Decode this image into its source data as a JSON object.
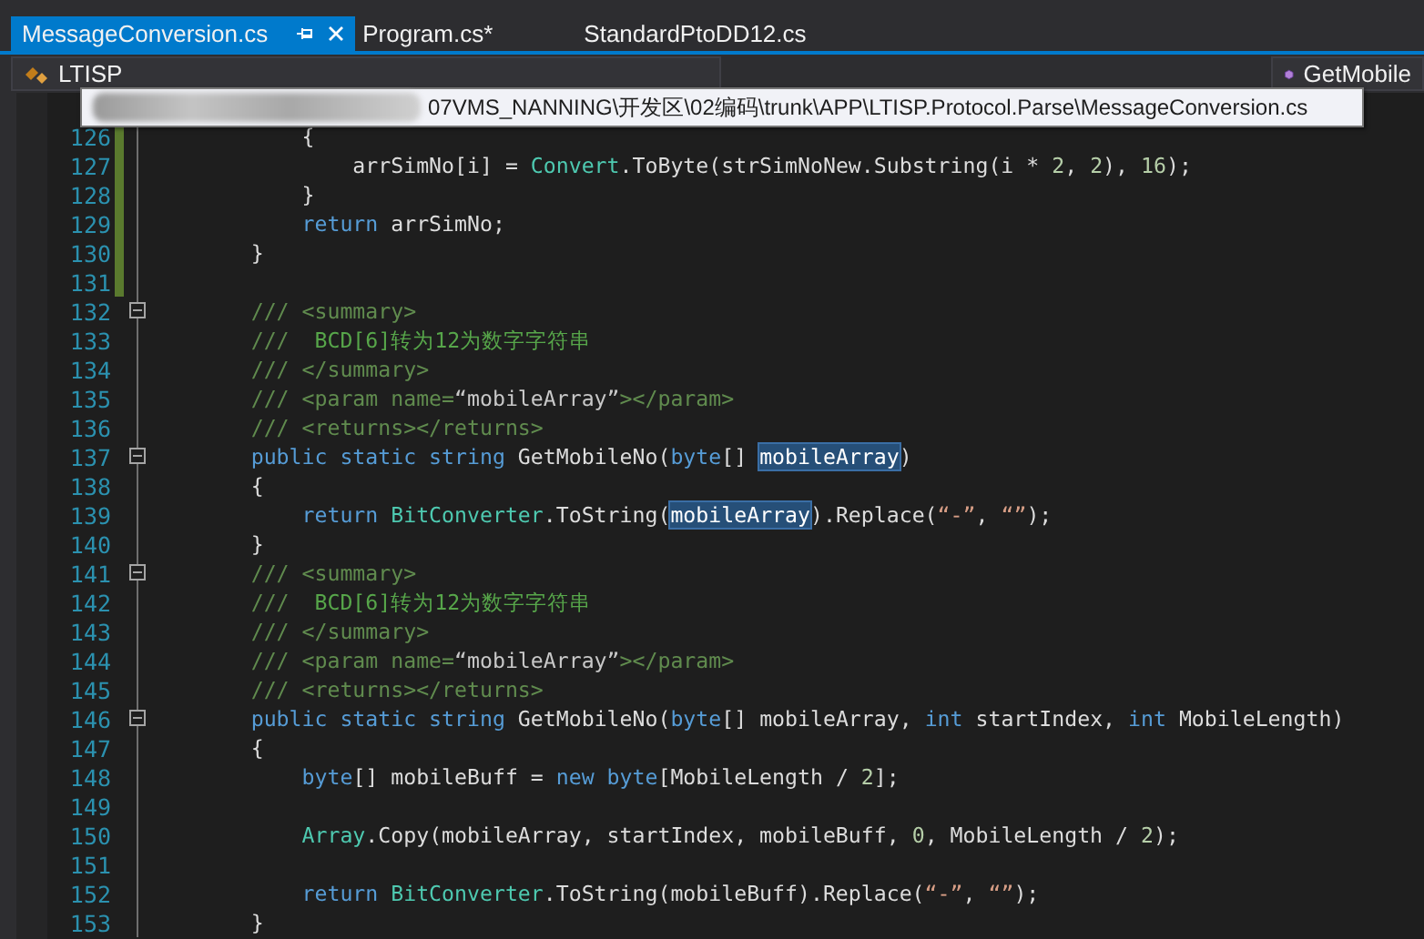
{
  "tabs": [
    {
      "label": "MessageConversion.cs",
      "selected": true
    },
    {
      "label": "Program.cs*",
      "selected": false
    },
    {
      "label": "StandardPtoDD12.cs",
      "selected": false
    }
  ],
  "navigation": {
    "left": "LTISP",
    "right": "GetMobile"
  },
  "tooltip": {
    "text": "07VMS_NANNING\\开发区\\02编码\\trunk\\APP\\LTISP.Protocol.Parse\\MessageConversion.cs"
  },
  "lines": [
    {
      "number": "126",
      "changed": true,
      "fold_toggle": false,
      "tokens": [
        {
          "kind": "plain",
          "text": "            {"
        }
      ]
    },
    {
      "number": "127",
      "changed": true,
      "fold_toggle": false,
      "tokens": [
        {
          "kind": "plain",
          "text": "                arrSimNo[i] = "
        },
        {
          "kind": "type",
          "text": "Convert"
        },
        {
          "kind": "plain",
          "text": ".ToByte(strSimNoNew.Substring(i * "
        },
        {
          "kind": "number",
          "text": "2"
        },
        {
          "kind": "plain",
          "text": ", "
        },
        {
          "kind": "number",
          "text": "2"
        },
        {
          "kind": "plain",
          "text": "), "
        },
        {
          "kind": "number",
          "text": "16"
        },
        {
          "kind": "plain",
          "text": ");"
        }
      ]
    },
    {
      "number": "128",
      "changed": true,
      "fold_toggle": false,
      "tokens": [
        {
          "kind": "plain",
          "text": "            }"
        }
      ]
    },
    {
      "number": "129",
      "changed": true,
      "fold_toggle": false,
      "tokens": [
        {
          "kind": "keyword",
          "text": "            return"
        },
        {
          "kind": "plain",
          "text": " arrSimNo;"
        }
      ]
    },
    {
      "number": "130",
      "changed": true,
      "fold_toggle": false,
      "tokens": [
        {
          "kind": "plain",
          "text": "        }"
        }
      ]
    },
    {
      "number": "131",
      "changed": true,
      "fold_toggle": false
    },
    {
      "number": "132",
      "changed": false,
      "fold_toggle": true,
      "tokens": [
        {
          "kind": "doc",
          "text": "        /// <summary>"
        }
      ]
    },
    {
      "number": "133",
      "changed": false,
      "fold_toggle": false,
      "tokens": [
        {
          "kind": "doc",
          "text": "        /// "
        },
        {
          "kind": "doc-text",
          "text": " BCD[6]转为12为数字字符串"
        }
      ]
    },
    {
      "number": "134",
      "changed": false,
      "fold_toggle": false,
      "tokens": [
        {
          "kind": "doc",
          "text": "        /// </summary>"
        }
      ]
    },
    {
      "number": "135",
      "changed": false,
      "fold_toggle": false,
      "tokens": [
        {
          "kind": "doc",
          "text": "        /// <param name="
        },
        {
          "kind": "doc-attr",
          "text": "“mobileArray”"
        },
        {
          "kind": "doc",
          "text": "></param>"
        }
      ]
    },
    {
      "number": "136",
      "changed": false,
      "fold_toggle": false,
      "tokens": [
        {
          "kind": "doc",
          "text": "        /// <returns></returns>"
        }
      ]
    },
    {
      "number": "137",
      "changed": false,
      "fold_toggle": true,
      "tokens": [
        {
          "kind": "keyword",
          "text": "        public static string"
        },
        {
          "kind": "plain",
          "text": " GetMobileNo("
        },
        {
          "kind": "keyword",
          "text": "byte"
        },
        {
          "kind": "plain",
          "text": "[] "
        },
        {
          "kind": "highlight",
          "text": "mobileArray"
        },
        {
          "kind": "plain",
          "text": ")"
        }
      ]
    },
    {
      "number": "138",
      "changed": false,
      "fold_toggle": false,
      "tokens": [
        {
          "kind": "plain",
          "text": "        {"
        }
      ]
    },
    {
      "number": "139",
      "changed": false,
      "fold_toggle": false,
      "tokens": [
        {
          "kind": "keyword",
          "text": "            return"
        },
        {
          "kind": "type",
          "text": " BitConverter"
        },
        {
          "kind": "plain",
          "text": ".ToString("
        },
        {
          "kind": "highlight",
          "text": "mobileArray"
        },
        {
          "kind": "plain",
          "text": ").Replace("
        },
        {
          "kind": "string",
          "text": "“-”"
        },
        {
          "kind": "plain",
          "text": ", "
        },
        {
          "kind": "string",
          "text": "“”"
        },
        {
          "kind": "plain",
          "text": ");"
        }
      ]
    },
    {
      "number": "140",
      "changed": false,
      "fold_toggle": false,
      "tokens": [
        {
          "kind": "plain",
          "text": "        }"
        }
      ]
    },
    {
      "number": "141",
      "changed": false,
      "fold_toggle": true,
      "tokens": [
        {
          "kind": "doc",
          "text": "        /// <summary>"
        }
      ]
    },
    {
      "number": "142",
      "changed": false,
      "fold_toggle": false,
      "tokens": [
        {
          "kind": "doc",
          "text": "        /// "
        },
        {
          "kind": "doc-text",
          "text": " BCD[6]转为12为数字字符串"
        }
      ]
    },
    {
      "number": "143",
      "changed": false,
      "fold_toggle": false,
      "tokens": [
        {
          "kind": "doc",
          "text": "        /// </summary>"
        }
      ]
    },
    {
      "number": "144",
      "changed": false,
      "fold_toggle": false,
      "tokens": [
        {
          "kind": "doc",
          "text": "        /// <param name="
        },
        {
          "kind": "doc-attr",
          "text": "“mobileArray”"
        },
        {
          "kind": "doc",
          "text": "></param>"
        }
      ]
    },
    {
      "number": "145",
      "changed": false,
      "fold_toggle": false,
      "tokens": [
        {
          "kind": "doc",
          "text": "        /// <returns></returns>"
        }
      ]
    },
    {
      "number": "146",
      "changed": false,
      "fold_toggle": true,
      "tokens": [
        {
          "kind": "keyword",
          "text": "        public static string"
        },
        {
          "kind": "plain",
          "text": " GetMobileNo("
        },
        {
          "kind": "keyword",
          "text": "byte"
        },
        {
          "kind": "plain",
          "text": "[] mobileArray, "
        },
        {
          "kind": "keyword",
          "text": "int"
        },
        {
          "kind": "plain",
          "text": " startIndex, "
        },
        {
          "kind": "keyword",
          "text": "int"
        },
        {
          "kind": "plain",
          "text": " MobileLength)"
        }
      ]
    },
    {
      "number": "147",
      "changed": false,
      "fold_toggle": false,
      "tokens": [
        {
          "kind": "plain",
          "text": "        {"
        }
      ]
    },
    {
      "number": "148",
      "changed": false,
      "fold_toggle": false,
      "tokens": [
        {
          "kind": "keyword",
          "text": "            byte"
        },
        {
          "kind": "plain",
          "text": "[] mobileBuff = "
        },
        {
          "kind": "keyword",
          "text": "new byte"
        },
        {
          "kind": "plain",
          "text": "[MobileLength / "
        },
        {
          "kind": "number",
          "text": "2"
        },
        {
          "kind": "plain",
          "text": "];"
        }
      ]
    },
    {
      "number": "149",
      "changed": false,
      "fold_toggle": false
    },
    {
      "number": "150",
      "changed": false,
      "fold_toggle": false,
      "tokens": [
        {
          "kind": "type",
          "text": "            Array"
        },
        {
          "kind": "plain",
          "text": ".Copy(mobileArray, startIndex, mobileBuff, "
        },
        {
          "kind": "number",
          "text": "0"
        },
        {
          "kind": "plain",
          "text": ", MobileLength / "
        },
        {
          "kind": "number",
          "text": "2"
        },
        {
          "kind": "plain",
          "text": ");"
        }
      ]
    },
    {
      "number": "151",
      "changed": false,
      "fold_toggle": false
    },
    {
      "number": "152",
      "changed": false,
      "fold_toggle": false,
      "tokens": [
        {
          "kind": "keyword",
          "text": "            return"
        },
        {
          "kind": "type",
          "text": " BitConverter"
        },
        {
          "kind": "plain",
          "text": ".ToString(mobileBuff).Replace("
        },
        {
          "kind": "string",
          "text": "“-”"
        },
        {
          "kind": "plain",
          "text": ", "
        },
        {
          "kind": "string",
          "text": "“”"
        },
        {
          "kind": "plain",
          "text": ");"
        }
      ]
    },
    {
      "number": "153",
      "changed": false,
      "fold_toggle": false,
      "tokens": [
        {
          "kind": "plain",
          "text": "        }"
        }
      ]
    }
  ]
}
